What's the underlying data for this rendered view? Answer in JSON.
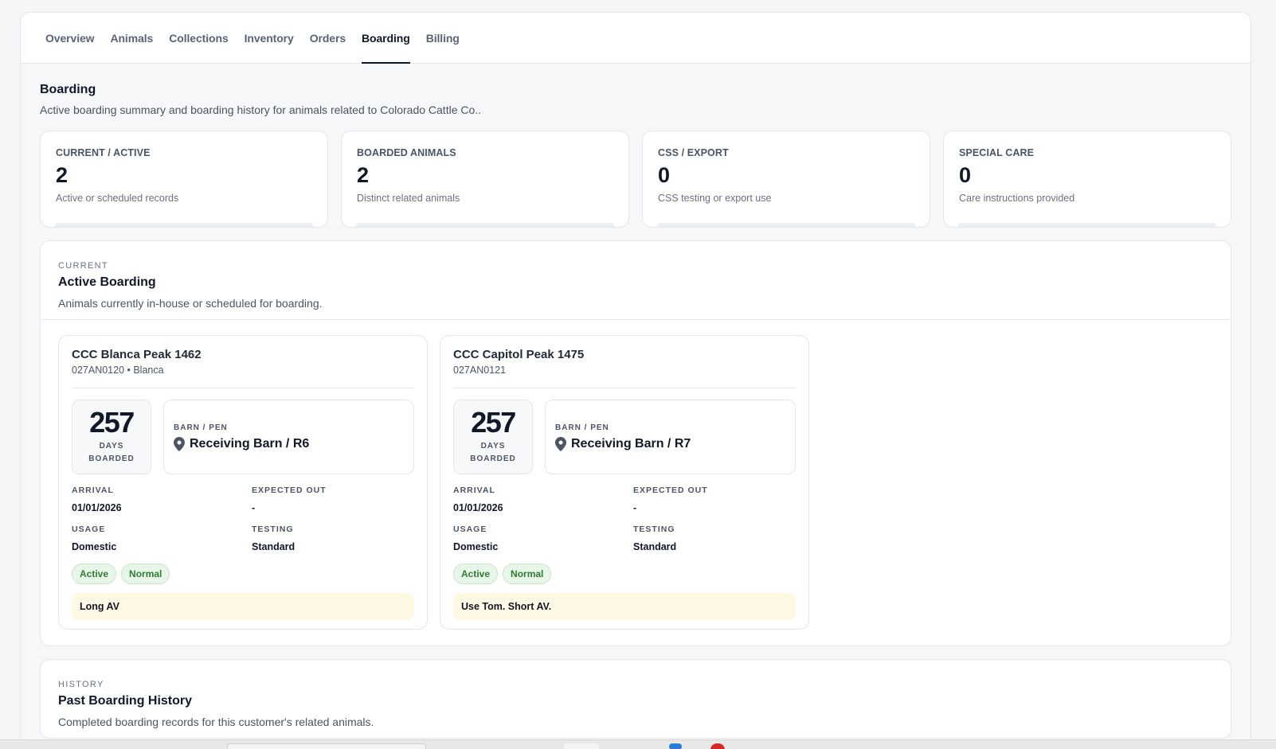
{
  "tabs": [
    "Overview",
    "Animals",
    "Collections",
    "Inventory",
    "Orders",
    "Boarding",
    "Billing"
  ],
  "active_tab": "Boarding",
  "page": {
    "title": "Boarding",
    "subtitle": "Active boarding summary and boarding history for animals related to Colorado Cattle Co.."
  },
  "stats": [
    {
      "label": "CURRENT / ACTIVE",
      "value": "2",
      "desc": "Active or scheduled records"
    },
    {
      "label": "BOARDED ANIMALS",
      "value": "2",
      "desc": "Distinct related animals"
    },
    {
      "label": "CSS / EXPORT",
      "value": "0",
      "desc": "CSS testing or export use"
    },
    {
      "label": "SPECIAL CARE",
      "value": "0",
      "desc": "Care instructions provided"
    }
  ],
  "active_section": {
    "eyebrow": "CURRENT",
    "title": "Active Boarding",
    "subtitle": "Animals currently in-house or scheduled for boarding."
  },
  "labels": {
    "days_line1": "DAYS",
    "days_line2": "BOARDED",
    "barn_pen": "BARN / PEN",
    "arrival": "ARRIVAL",
    "expected_out": "EXPECTED OUT",
    "usage": "USAGE",
    "testing": "TESTING"
  },
  "cards": [
    {
      "name": "CCC Blanca Peak 1462",
      "meta": "027AN0120 • Blanca",
      "days": "257",
      "pen": "Receiving Barn / R6",
      "arrival": "01/01/2026",
      "expected_out": "-",
      "usage": "Domestic",
      "testing": "Standard",
      "badges": [
        "Active",
        "Normal"
      ],
      "note": "Long AV"
    },
    {
      "name": "CCC Capitol Peak 1475",
      "meta": "027AN0121",
      "days": "257",
      "pen": "Receiving Barn / R7",
      "arrival": "01/01/2026",
      "expected_out": "-",
      "usage": "Domestic",
      "testing": "Standard",
      "badges": [
        "Active",
        "Normal"
      ],
      "note": "Use Tom. Short AV."
    }
  ],
  "history_section": {
    "eyebrow": "HISTORY",
    "title": "Past Boarding History",
    "subtitle": "Completed boarding records for this customer's related animals."
  },
  "colors": {
    "badge_green": "#2e7d32",
    "note_bg": "#fff8e5",
    "active_tab_underline": "#111827"
  }
}
